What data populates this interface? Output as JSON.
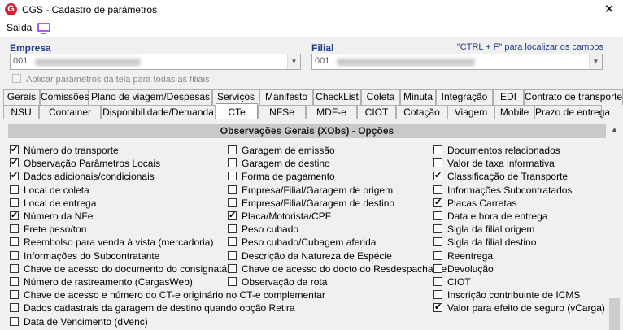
{
  "window": {
    "title": "CGS - Cadastro de parâmetros",
    "close": "✕"
  },
  "menu": {
    "saida": "Saída",
    "icon": "monitor-icon"
  },
  "form": {
    "empresa_label": "Empresa",
    "empresa_value": "001",
    "filial_label": "Filial",
    "filial_value": "001",
    "hint": "\"CTRL + F\" para localizar os campos",
    "apply_all": "Aplicar parâmetros da tela para todas as filiais"
  },
  "tabs_row1": [
    "Gerais",
    "Comissões",
    "Plano de viagem/Despesas",
    "Serviços",
    "Manifesto",
    "CheckList",
    "Coleta",
    "Minuta",
    "Integração",
    "EDI",
    "Contrato de transporte"
  ],
  "tabs_row2": [
    "NSU",
    "Container",
    "Disponibilidade/Demanda",
    "CTe",
    "NFSe",
    "MDF-e",
    "CIOT",
    "Cotação",
    "Viagem",
    "Mobile",
    "Prazo de entrega"
  ],
  "active_tab": "CTe",
  "section": {
    "title": "Observações Gerais (XObs) - Opções"
  },
  "options_col1": [
    {
      "label": "Número do transporte",
      "checked": true
    },
    {
      "label": "Observação Parâmetros Locais",
      "checked": true
    },
    {
      "label": "Dados adicionais/condicionais",
      "checked": true
    },
    {
      "label": "Local de coleta",
      "checked": false
    },
    {
      "label": "Local de entrega",
      "checked": false
    },
    {
      "label": "Número da NFe",
      "checked": true
    },
    {
      "label": "Frete peso/ton",
      "checked": false
    },
    {
      "label": "Reembolso para venda à vista (mercadoria)",
      "checked": false
    },
    {
      "label": "Informações do Subcontratante",
      "checked": false
    },
    {
      "label": "Chave de acesso do documento do consignatário",
      "checked": false
    },
    {
      "label": "Número de rastreamento (CargasWeb)",
      "checked": false
    }
  ],
  "options_col2": [
    {
      "label": "Garagem de emissão",
      "checked": false
    },
    {
      "label": "Garagem de destino",
      "checked": false
    },
    {
      "label": "Forma de pagamento",
      "checked": false
    },
    {
      "label": "Empresa/Filial/Garagem de origem",
      "checked": false
    },
    {
      "label": "Empresa/Filial/Garagem de destino",
      "checked": false
    },
    {
      "label": "Placa/Motorista/CPF",
      "checked": true
    },
    {
      "label": "Peso cubado",
      "checked": false
    },
    {
      "label": "Peso cubado/Cubagem aferida",
      "checked": false
    },
    {
      "label": "Descrição da Natureza de Espécie",
      "checked": false
    },
    {
      "label": "Chave de acesso do docto do Resdespachante",
      "checked": false
    },
    {
      "label": "Observação da rota",
      "checked": false
    }
  ],
  "options_col3": [
    {
      "label": "Documentos relacionados",
      "checked": false
    },
    {
      "label": "Valor de taxa informativa",
      "checked": false
    },
    {
      "label": "Classificação de Transporte",
      "checked": true
    },
    {
      "label": "Informações Subcontratados",
      "checked": false
    },
    {
      "label": "Placas Carretas",
      "checked": true
    },
    {
      "label": "Data e hora de entrega",
      "checked": false
    },
    {
      "label": "Sigla da filial origem",
      "checked": false
    },
    {
      "label": "Sigla da filial destino",
      "checked": false
    },
    {
      "label": "Reentrega",
      "checked": false
    },
    {
      "label": "Devolução",
      "checked": false
    },
    {
      "label": "CIOT",
      "checked": false
    },
    {
      "label": "Inscrição contribuinte de ICMS",
      "checked": false
    },
    {
      "label": "Valor para efeito de seguro (vCarga)",
      "checked": true
    }
  ],
  "options_wide": [
    {
      "label": "Chave de acesso e número do CT-e originário no CT-e complementar",
      "checked": false
    },
    {
      "label": "Dados cadastrais da garagem de destino quando opção Retira",
      "checked": false
    },
    {
      "label": "Data de Vencimento (dVenc)",
      "checked": false
    }
  ]
}
